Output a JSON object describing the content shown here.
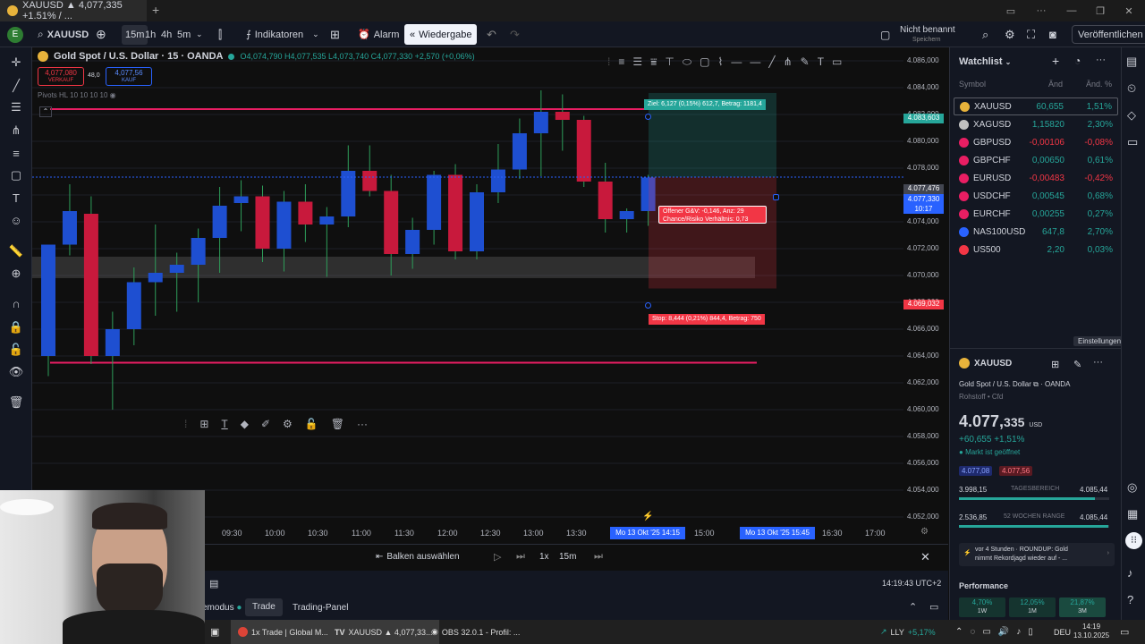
{
  "browser_tab": {
    "title": "XAUUSD ▲ 4,077,335 +1.51% / ..."
  },
  "toolbar": {
    "symbol": "XAUUSD",
    "intervals": [
      "15m",
      "1h",
      "4h",
      "5m"
    ],
    "indicators_label": "Indikatoren",
    "alarm_label": "Alarm",
    "replay_label": "Wiedergabe",
    "layout_name": "Nicht benannt",
    "layout_sub": "Speichern",
    "publish_label": "Veröffentlichen"
  },
  "legend": {
    "title": "Gold Spot / U.S. Dollar · 15 · OANDA",
    "ohlc": "O4,074,790 H4,077,535 L4,073,740 C4,077,330 +2,570 (+0,06%)",
    "sell_price": "4,077,080",
    "sell_label": "VERKAUF",
    "spread": "48,0",
    "buy_price": "4,077,56",
    "buy_label": "KAUF",
    "indicator": "Pivots HL 10 10 10 10"
  },
  "position": {
    "target_label": "Ziel: 6,127 (0,15%) 612,7, Betrag: 1181,4",
    "open_pnl": "Offener G&V: -0,146, Anz: 29",
    "risk_reward": "Chance/Risiko Verhältnis: 0,73",
    "stop_label": "Stop: 8,444 (0,21%) 844,4, Betrag: 750"
  },
  "price_axis": {
    "ticks": [
      "4.086,000",
      "4.084,000",
      "4.082,000",
      "4.080,000",
      "4.078,000",
      "4.076,000",
      "4.074,000",
      "4.072,000",
      "4.070,000",
      "4.068,000",
      "4.066,000",
      "4.064,000",
      "4.062,000",
      "4.060,000",
      "4.058,000",
      "4.056,000",
      "4.054,000",
      "4.052,000"
    ],
    "target_tag": "4.083,603",
    "current_tag": "4.077,476",
    "last_tag": "4.077,330",
    "countdown": "10:17",
    "stop_tag": "4.069,032"
  },
  "time_axis": {
    "ticks": [
      "09:30",
      "10:00",
      "10:30",
      "11:00",
      "11:30",
      "12:00",
      "12:30",
      "13:00",
      "13:30",
      "15:00",
      "16:30",
      "17:00"
    ],
    "marker1": "Mo 13 Okt '25  14:15",
    "marker2": "Mo 13 Okt '25  15:45"
  },
  "replay_bar": {
    "select_bar": "Balken auswählen",
    "speed": "1x",
    "interval": "15m"
  },
  "footer": {
    "clock": "14:19:43 UTC+2",
    "mode_suffix": "emodus",
    "trade_tab": "Trade",
    "panel_tab": "Trading-Panel"
  },
  "watchlist": {
    "title": "Watchlist",
    "headers": {
      "symbol": "Symbol",
      "change": "Änd",
      "change_pct": "Änd. %"
    },
    "rows": [
      {
        "symbol": "XAUUSD",
        "chg": "60,655",
        "pct": "1,51%",
        "dir": "up"
      },
      {
        "symbol": "XAGUSD",
        "chg": "1,15820",
        "pct": "2,30%",
        "dir": "up"
      },
      {
        "symbol": "GBPUSD",
        "chg": "-0,00106",
        "pct": "-0,08%",
        "dir": "down"
      },
      {
        "symbol": "GBPCHF",
        "chg": "0,00650",
        "pct": "0,61%",
        "dir": "up"
      },
      {
        "symbol": "EURUSD",
        "chg": "-0,00483",
        "pct": "-0,42%",
        "dir": "down"
      },
      {
        "symbol": "USDCHF",
        "chg": "0,00545",
        "pct": "0,68%",
        "dir": "up"
      },
      {
        "symbol": "EURCHF",
        "chg": "0,00255",
        "pct": "0,27%",
        "dir": "up"
      },
      {
        "symbol": "NAS100USD",
        "chg": "647,8",
        "pct": "2,70%",
        "dir": "up"
      },
      {
        "symbol": "US500",
        "chg": "2,20",
        "pct": "0,03%",
        "dir": "up"
      }
    ]
  },
  "details": {
    "tooltip": "Einstellungen",
    "symbol": "XAUUSD",
    "name": "Gold Spot / U.S. Dollar",
    "exchange": "OANDA",
    "category": "Rohstoff • Cfd",
    "price_main": "4.077,",
    "price_small": "335",
    "currency": "USD",
    "change": "+60,655 +1,51%",
    "market_status": "Markt ist geöffnet",
    "bid": "4.077,08",
    "ask": "4.077,56",
    "day_low": "3.998,15",
    "day_label": "TAGESBEREICH",
    "day_high": "4.085,44",
    "wk_low": "2.536,85",
    "wk_label": "52 WOCHEN RANGE",
    "wk_high": "4.085,44",
    "news_time": "vor 4 Stunden · ROUNDUP: Gold",
    "news_text": "nimmt Rekordjagd wieder auf - ...",
    "performance": "Performance",
    "perf": [
      {
        "val": "4,70%",
        "per": "1W"
      },
      {
        "val": "12,05%",
        "per": "1M"
      },
      {
        "val": "21,87%",
        "per": "3M"
      }
    ]
  },
  "taskbar": {
    "app1": "1x Trade | Global M...",
    "app2": "XAUUSD ▲ 4,077,33...",
    "app3": "OBS 32.0.1 - Profil: ...",
    "ticker": "LLY",
    "ticker_chg": "+5,17%",
    "lang": "DEU",
    "time": "14:19",
    "date": "13.10.2025"
  },
  "chart_data": {
    "type": "candlestick",
    "title": "Gold Spot / U.S. Dollar · 15 · OANDA",
    "y_range": [
      4051,
      4087
    ],
    "x_labels": [
      "09:30",
      "10:00",
      "10:30",
      "11:00",
      "11:30",
      "12:00",
      "12:30",
      "13:00",
      "13:30"
    ],
    "candles": [
      [
        4064.0,
        4072.3,
        4062.5,
        4072.3
      ],
      [
        4072.3,
        4076.8,
        4071.5,
        4074.8
      ],
      [
        4074.6,
        4075.9,
        4063.4,
        4064.0
      ],
      [
        4064.0,
        4067.3,
        4060.0,
        4066.0
      ],
      [
        4066.0,
        4070.6,
        4064.8,
        4069.5
      ],
      [
        4069.5,
        4073.8,
        4067.0,
        4070.2
      ],
      [
        4070.2,
        4071.7,
        4067.3,
        4070.8
      ],
      [
        4070.8,
        4073.5,
        4068.0,
        4072.8
      ],
      [
        4072.8,
        4076.6,
        4070.2,
        4075.2
      ],
      [
        4075.4,
        4077.1,
        4073.3,
        4075.9
      ],
      [
        4075.9,
        4076.7,
        4071.0,
        4072.0
      ],
      [
        4072.0,
        4076.3,
        4070.3,
        4075.5
      ],
      [
        4075.5,
        4076.8,
        4072.5,
        4073.8
      ],
      [
        4073.8,
        4075.1,
        4069.9,
        4074.4
      ],
      [
        4074.4,
        4079.7,
        4073.6,
        4077.8
      ],
      [
        4077.8,
        4079.7,
        4075.9,
        4076.3
      ],
      [
        4076.3,
        4077.5,
        4070.0,
        4071.6
      ],
      [
        4071.6,
        4074.3,
        4070.5,
        4073.4
      ],
      [
        4073.4,
        4077.8,
        4072.3,
        4077.5
      ],
      [
        4077.5,
        4078.3,
        4071.2,
        4071.8
      ],
      [
        4071.8,
        4076.8,
        4071.2,
        4076.2
      ],
      [
        4076.2,
        4079.8,
        4075.4,
        4077.9
      ],
      [
        4077.9,
        4081.7,
        4077.2,
        4080.6
      ],
      [
        4080.6,
        4083.8,
        4077.4,
        4082.2
      ],
      [
        4082.2,
        4083.5,
        4079.3,
        4081.6
      ],
      [
        4081.6,
        4081.9,
        4076.6,
        4077.0
      ],
      [
        4077.0,
        4078.4,
        4073.2,
        4074.2
      ],
      [
        4074.2,
        4075.0,
        4073.2,
        4074.8
      ],
      [
        4074.8,
        4077.5,
        4073.7,
        4077.3
      ]
    ],
    "hlines": [
      {
        "price": 4082.4,
        "color": "#e91e63"
      },
      {
        "price": 4063.5,
        "color": "#e91e63"
      }
    ],
    "zone": [
      4069.8,
      4071.4
    ],
    "position": {
      "entry": 4077.33,
      "target": 4083.603,
      "stop": 4069.032
    }
  }
}
